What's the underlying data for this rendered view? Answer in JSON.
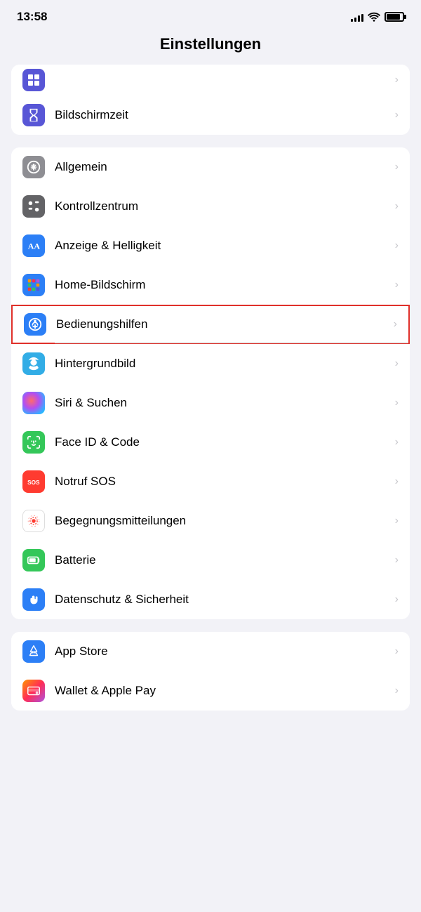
{
  "statusBar": {
    "time": "13:58",
    "signalBars": [
      4,
      6,
      9,
      11,
      13
    ],
    "batteryLevel": 85
  },
  "pageTitle": "Einstellungen",
  "groups": [
    {
      "id": "group-partial",
      "items": [
        {
          "id": "bildschirmzeit",
          "label": "Bildschirmzeit",
          "iconBg": "icon-blue",
          "icon": "hourglass",
          "highlighted": false
        }
      ]
    },
    {
      "id": "group-display",
      "items": [
        {
          "id": "allgemein",
          "label": "Allgemein",
          "iconBg": "icon-gray",
          "icon": "gear",
          "highlighted": false
        },
        {
          "id": "kontrollzentrum",
          "label": "Kontrollzentrum",
          "iconBg": "icon-dark-gray",
          "icon": "sliders",
          "highlighted": false
        },
        {
          "id": "anzeige",
          "label": "Anzeige & Helligkeit",
          "iconBg": "icon-blue",
          "icon": "aa",
          "highlighted": false
        },
        {
          "id": "home-bildschirm",
          "label": "Home-Bildschirm",
          "iconBg": "icon-blue",
          "icon": "grid",
          "highlighted": false
        },
        {
          "id": "bedienungshilfen",
          "label": "Bedienungshilfen",
          "iconBg": "icon-blue",
          "icon": "accessibility",
          "highlighted": true
        },
        {
          "id": "hintergrundbild",
          "label": "Hintergrundbild",
          "iconBg": "icon-cyan",
          "icon": "flower",
          "highlighted": false
        },
        {
          "id": "siri",
          "label": "Siri & Suchen",
          "iconBg": "icon-dark",
          "icon": "siri",
          "highlighted": false
        },
        {
          "id": "faceid",
          "label": "Face ID & Code",
          "iconBg": "icon-green",
          "icon": "faceid",
          "highlighted": false
        },
        {
          "id": "notruf",
          "label": "Notruf SOS",
          "iconBg": "icon-red",
          "icon": "sos",
          "highlighted": false
        },
        {
          "id": "begegnungsmitteilungen",
          "label": "Begegnungsmitteilungen",
          "iconBg": "icon-white",
          "icon": "exposure",
          "highlighted": false
        },
        {
          "id": "batterie",
          "label": "Batterie",
          "iconBg": "icon-green",
          "icon": "battery",
          "highlighted": false
        },
        {
          "id": "datenschutz",
          "label": "Datenschutz & Sicherheit",
          "iconBg": "icon-blue",
          "icon": "hand",
          "highlighted": false
        }
      ]
    },
    {
      "id": "group-appstore",
      "items": [
        {
          "id": "appstore",
          "label": "App Store",
          "iconBg": "icon-blue",
          "icon": "appstore",
          "highlighted": false
        },
        {
          "id": "wallet",
          "label": "Wallet & Apple Pay",
          "iconBg": "icon-dark",
          "icon": "wallet",
          "highlighted": false
        }
      ]
    }
  ],
  "labels": {
    "chevron": "›"
  }
}
